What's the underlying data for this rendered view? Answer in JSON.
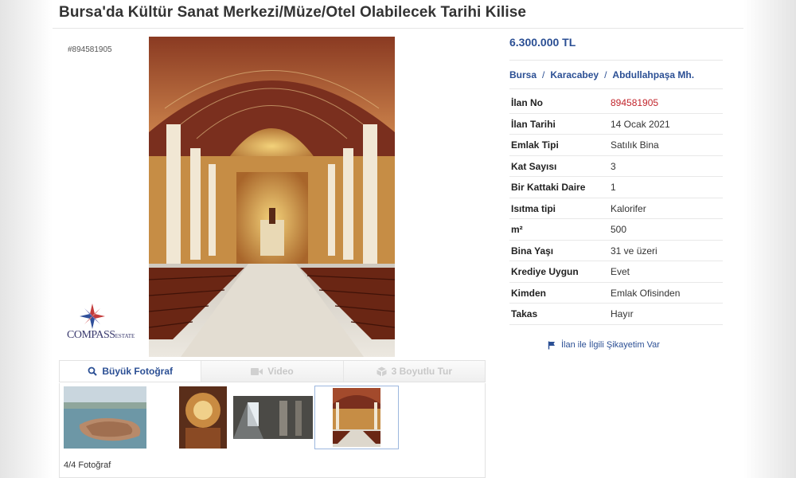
{
  "listing": {
    "title": "Bursa'da Kültür Sanat Merkezi/Müze/Otel Olabilecek Tarihi Kilise",
    "id_label": "#894581905",
    "price": "6.300.000 TL",
    "location": {
      "city": "Bursa",
      "district": "Karacabey",
      "neighborhood": "Abdullahpaşa Mh."
    },
    "details": [
      {
        "key": "İlan No",
        "value": "894581905"
      },
      {
        "key": "İlan Tarihi",
        "value": "14 Ocak 2021"
      },
      {
        "key": "Emlak Tipi",
        "value": "Satılık Bina"
      },
      {
        "key": "Kat Sayısı",
        "value": "3"
      },
      {
        "key": "Bir Kattaki Daire",
        "value": "1"
      },
      {
        "key": "Isıtma tipi",
        "value": "Kalorifer"
      },
      {
        "key": "m²",
        "value": "500"
      },
      {
        "key": "Bina Yaşı",
        "value": "31 ve üzeri"
      },
      {
        "key": "Krediye Uygun",
        "value": "Evet"
      },
      {
        "key": "Kimden",
        "value": "Emlak Ofisinden"
      },
      {
        "key": "Takas",
        "value": "Hayır"
      }
    ],
    "complaint_link": "İlan ile İlgili Şikayetim Var"
  },
  "agency": {
    "logo_name": "COMPASS",
    "logo_suffix": "ESTATE"
  },
  "media": {
    "tabs": [
      {
        "label": "Büyük Fotoğraf",
        "icon": "search-icon",
        "active": true
      },
      {
        "label": "Video",
        "icon": "video-camera-icon",
        "active": false
      },
      {
        "label": "3 Boyutlu Tur",
        "icon": "cube-icon",
        "active": false
      }
    ],
    "photo_count": "4/4 Fotoğraf",
    "selected_index": 3
  },
  "colors": {
    "link": "#2b4f94",
    "accent_red": "#c2252c"
  }
}
